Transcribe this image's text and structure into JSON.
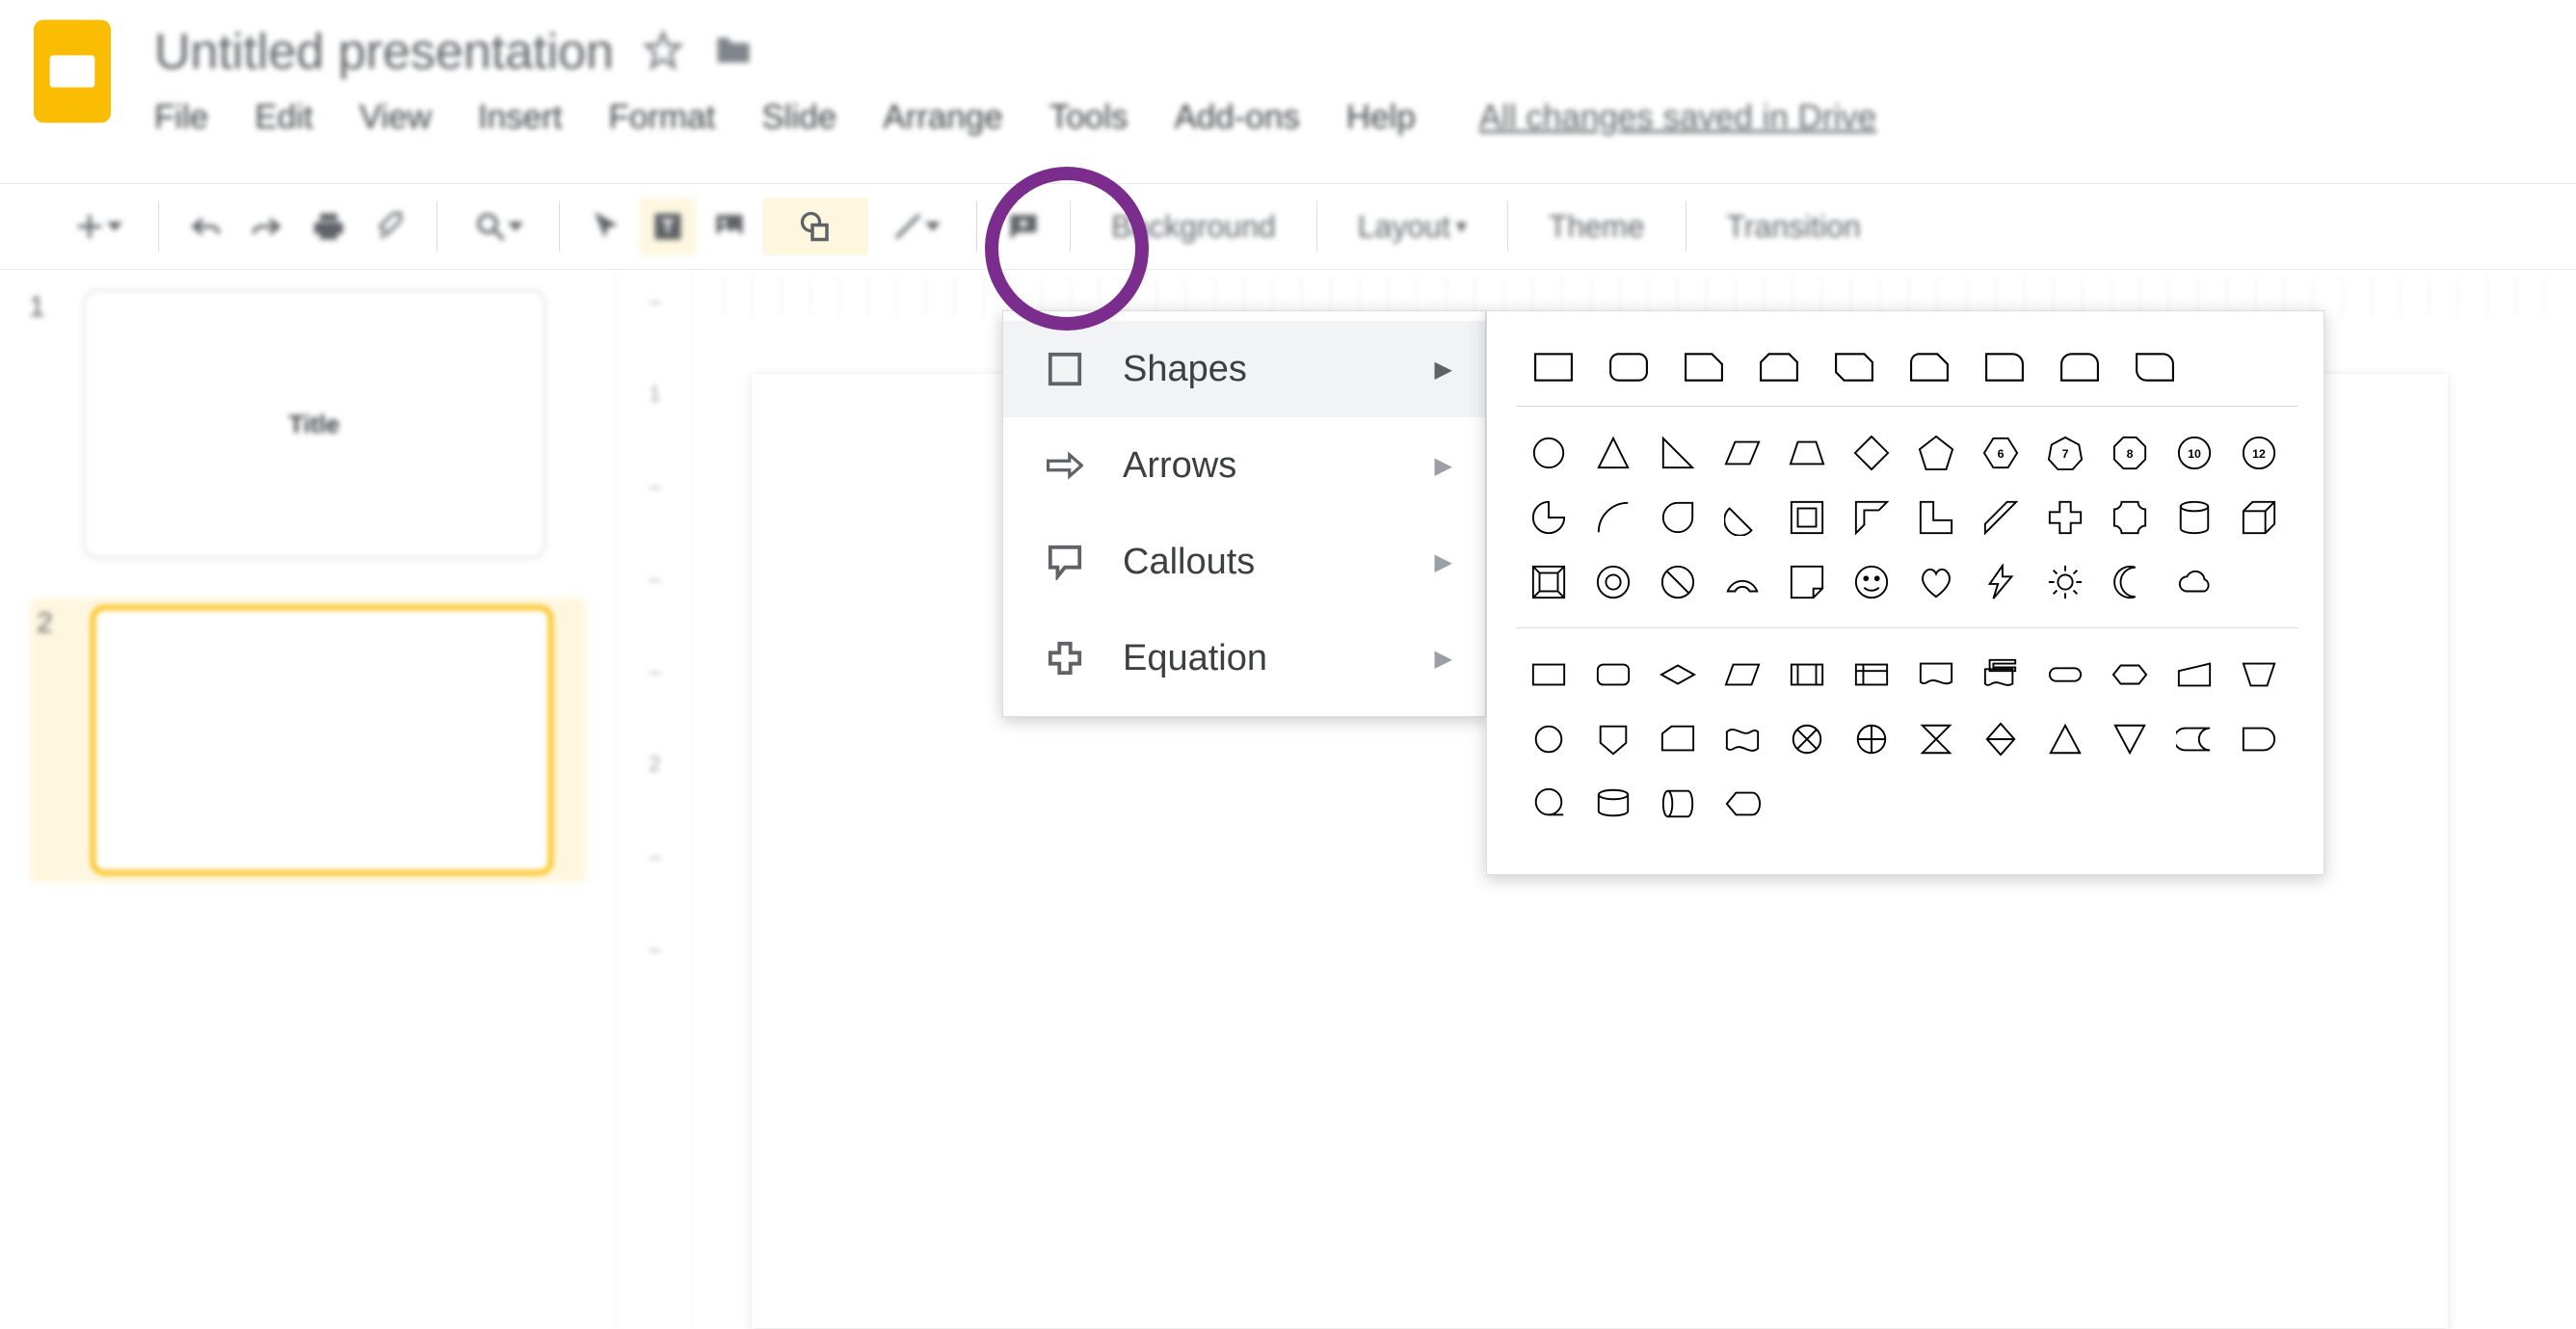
{
  "app": {
    "icon": "slides"
  },
  "doc": {
    "title": "Untitled presentation",
    "star_state": "unstarred",
    "drive_status": "All changes saved in Drive"
  },
  "menubar": {
    "items": [
      "File",
      "Edit",
      "View",
      "Insert",
      "Format",
      "Slide",
      "Arrange",
      "Tools",
      "Add-ons",
      "Help"
    ]
  },
  "toolbar": {
    "new_slide": "new-slide",
    "undo": "undo",
    "redo": "redo",
    "print": "print",
    "paint_format": "paint-format",
    "zoom": "zoom",
    "select": "select",
    "text_box": "text-box",
    "image": "image",
    "shape": "shape",
    "line": "line",
    "comment": "comment",
    "background_label": "Background",
    "layout_label": "Layout",
    "theme_label": "Theme",
    "transition_label": "Transition"
  },
  "slides": [
    {
      "number": "1",
      "preview_text": "Title",
      "selected": false
    },
    {
      "number": "2",
      "preview_text": "",
      "selected": true
    }
  ],
  "shape_menu": {
    "items": [
      {
        "key": "shapes",
        "label": "Shapes",
        "icon": "square-icon"
      },
      {
        "key": "arrows",
        "label": "Arrows",
        "icon": "arrow-right-icon"
      },
      {
        "key": "callouts",
        "label": "Callouts",
        "icon": "callout-icon"
      },
      {
        "key": "equation",
        "label": "Equation",
        "icon": "plus-outline-icon"
      }
    ],
    "active": "shapes"
  },
  "shapes_gallery": {
    "group1": [
      "rectangle",
      "round-rectangle",
      "snip-single-corner",
      "snip-same-side",
      "snip-diag-corner",
      "snip-round-single",
      "round-single-corner",
      "round-same-side",
      "round-diag-corner"
    ],
    "group2_row1": [
      "oval",
      "triangle",
      "right-triangle",
      "parallelogram",
      "trapezoid",
      "diamond",
      "pentagon",
      "hexagon",
      "heptagon",
      "octagon",
      "decagon",
      "dodecagon"
    ],
    "group2_row2": [
      "pie",
      "arc",
      "teardrop",
      "chord",
      "frame",
      "half-frame",
      "l-shape",
      "diag-stripe",
      "plus",
      "plaque",
      "can",
      "cube"
    ],
    "group2_row3": [
      "bevel",
      "donut",
      "no-symbol",
      "block-arc",
      "folded-corner",
      "smiley",
      "heart",
      "lightning",
      "sun",
      "moon",
      "cloud"
    ],
    "group3_row1": [
      "flow-process",
      "flow-alt-process",
      "flow-decision",
      "flow-data",
      "flow-predef-process",
      "flow-internal-storage",
      "flow-document",
      "flow-multidocument",
      "flow-terminator",
      "flow-preparation",
      "flow-manual-input",
      "flow-manual-operation"
    ],
    "group3_row2": [
      "flow-connector",
      "flow-offpage",
      "flow-card",
      "flow-punched-tape",
      "flow-summing-junction",
      "flow-or",
      "flow-collate",
      "flow-sort",
      "flow-extract",
      "flow-merge",
      "flow-stored-data",
      "flow-delay"
    ],
    "group3_row3": [
      "flow-seq-access",
      "flow-magnetic-disk",
      "flow-direct-access",
      "flow-display"
    ]
  }
}
